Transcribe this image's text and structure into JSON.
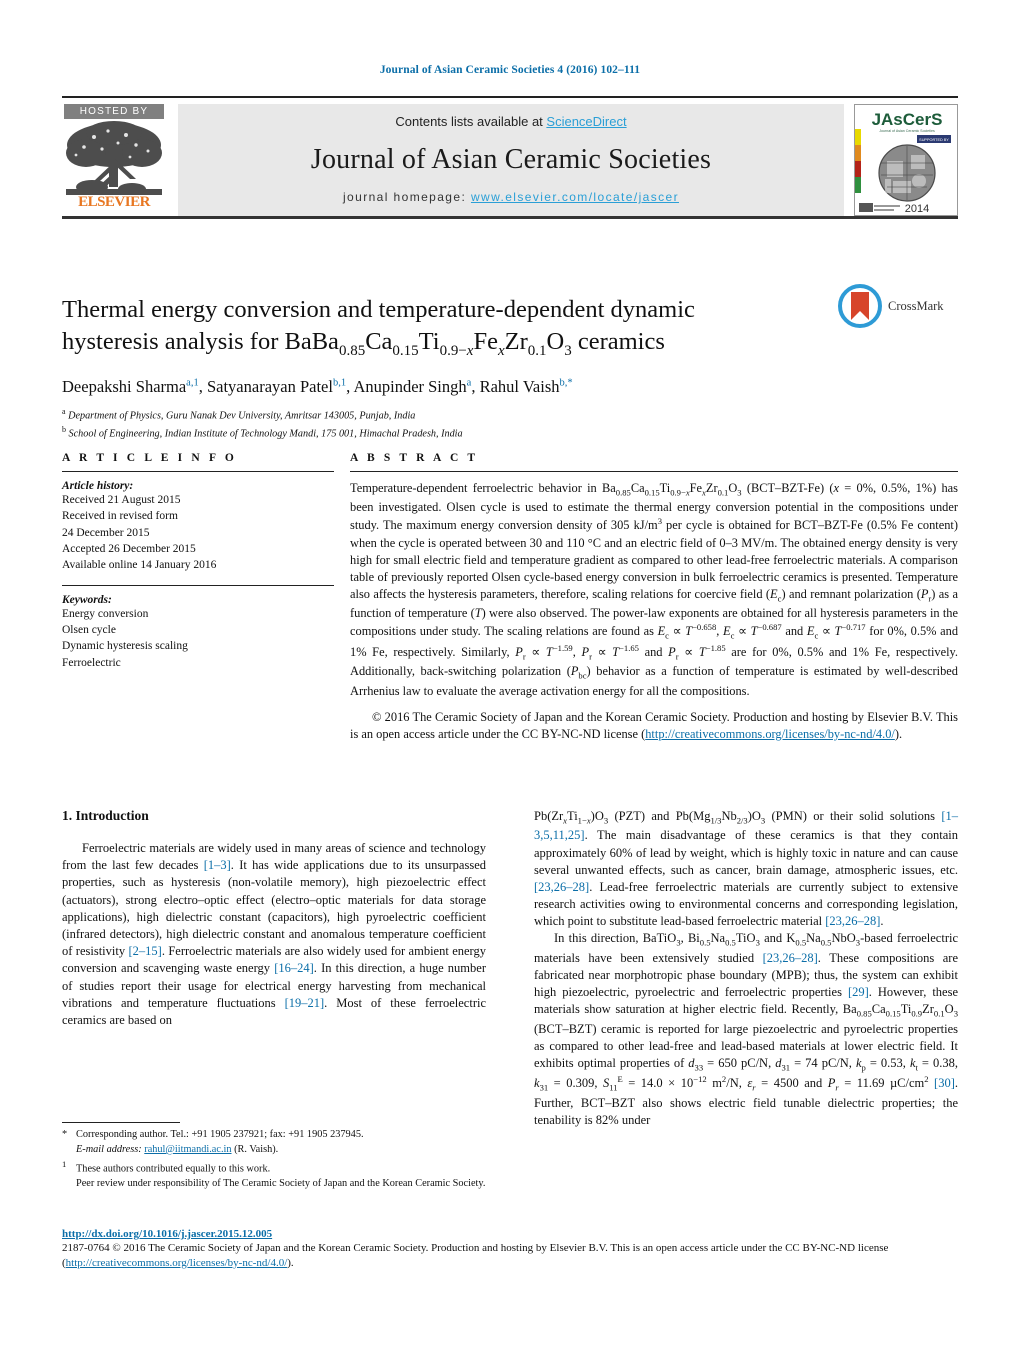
{
  "running_head": "Journal of Asian Ceramic Societies 4 (2016) 102–111",
  "masthead": {
    "hosted_by": "HOSTED BY",
    "publisher": "ELSEVIER",
    "contents_prefix": "Contents lists available at ",
    "contents_link": "ScienceDirect",
    "journal_name": "Journal of Asian Ceramic Societies",
    "homepage_label": "journal homepage: ",
    "homepage_url": "www.elsevier.com/locate/jascer",
    "cover": {
      "brand": "JAsCerS",
      "subtitle": "Journal of Asian Ceramic Societies",
      "badge": "SUPPORTED BY",
      "year": "2014"
    }
  },
  "article": {
    "title_line1": "Thermal energy conversion and temperature-dependent dynamic",
    "title_line2_pre": "hysteresis analysis for Ba",
    "title_formula": "Ba0.85Ca0.15Ti0.9−xFexZr0.1O3",
    "title_line2_post": " ceramics",
    "crossmark_label": "CrossMark",
    "authors_text": "Deepakshi Sharma, Satyanarayan Patel, Anupinder Singh, Rahul Vaish",
    "authors": [
      {
        "name": "Deepakshi Sharma",
        "marks": "a,1"
      },
      {
        "name": "Satyanarayan Patel",
        "marks": "b,1"
      },
      {
        "name": "Anupinder Singh",
        "marks": "a"
      },
      {
        "name": "Rahul Vaish",
        "marks": "b,*"
      }
    ],
    "affiliations": [
      {
        "mark": "a",
        "text": "Department of Physics, Guru Nanak Dev University, Amritsar 143005, Punjab, India"
      },
      {
        "mark": "b",
        "text": "School of Engineering, Indian Institute of Technology Mandi, 175 001, Himachal Pradesh, India"
      }
    ]
  },
  "article_info": {
    "heading": "A R T I C L E   I N F O",
    "history_label": "Article history:",
    "history": [
      "Received 21 August 2015",
      "Received in revised form",
      "24 December 2015",
      "Accepted 26 December 2015",
      "Available online 14 January 2016"
    ],
    "keywords_label": "Keywords:",
    "keywords": [
      "Energy conversion",
      "Olsen cycle",
      "Dynamic hysteresis scaling",
      "Ferroelectric"
    ]
  },
  "abstract": {
    "heading": "A B S T R A C T",
    "copyright_text": "© 2016 The Ceramic Society of Japan and the Korean Ceramic Society. Production and hosting by Elsevier B.V. This is an open access article under the CC BY-NC-ND license (",
    "copyright_link": "http://creativecommons.org/licenses/by-nc-nd/4.0/",
    "copyright_tail": ")."
  },
  "introduction": {
    "heading": "1.  Introduction"
  },
  "footnotes": {
    "corresponding": "Corresponding author. Tel.: +91 1905 237921; fax: +91 1905 237945.",
    "email_label": "E-mail address:",
    "email": "rahul@iitmandi.ac.in",
    "email_owner": "(R. Vaish).",
    "equal_contrib": "These authors contributed equally to this work.",
    "peer_review": "Peer review under responsibility of The Ceramic Society of Japan and the Korean Ceramic Society."
  },
  "footer": {
    "doi": "http://dx.doi.org/10.1016/j.jascer.2015.12.005",
    "line1": "2187-0764 © 2016 The Ceramic Society of Japan and the Korean Ceramic Society. Production and hosting by Elsevier B.V. This is an open access article under the CC BY-NC-ND",
    "line2_pre": "license (",
    "line2_link": "http://creativecommons.org/licenses/by-nc-nd/4.0/",
    "line2_post": ")."
  },
  "colors": {
    "link_blue": "#0b6ea8",
    "sciencedirect_blue": "#2a9fd6",
    "elsevier_orange": "#e87722",
    "panel_grey": "#e8e8e8",
    "hosted_bar_grey": "#808080"
  }
}
